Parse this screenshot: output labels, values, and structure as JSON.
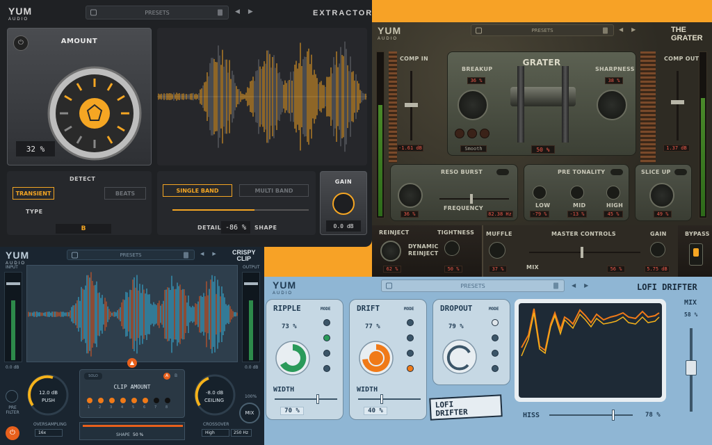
{
  "extractor": {
    "logo": "YUM",
    "logo_sub": "AUDIO",
    "presets": "PRESETS",
    "brand": "EXTRACTOR",
    "amount_label": "AMOUNT",
    "amount_value": "32 %",
    "detect_label": "DETECT",
    "transient_label": "TRANSIENT",
    "beats_label": "BEATS",
    "type_label": "TYPE",
    "type_value": "B",
    "single_band_label": "SINGLE BAND",
    "multi_band_label": "MULTI BAND",
    "detail_label": "DETAIL",
    "detail_value": "-86 %",
    "shape_label": "SHAPE",
    "gain_label": "GAIN",
    "gain_value": "0.0 dB",
    "waveform_color": "#f5a623"
  },
  "grater": {
    "logo": "YUM",
    "logo_sub": "AUDIO",
    "presets": "PRESETS",
    "brand": "THE GRATER",
    "title": "GRATER",
    "comp_in_label": "COMP IN",
    "comp_in_value": "-1.61 dB",
    "comp_out_label": "COMP OUT",
    "comp_out_value": "1.37 dB",
    "breakup_label": "BREAKUP",
    "breakup_value": "36 %",
    "sharpness_label": "SHARPNESS",
    "sharpness_value": "38 %",
    "smooth_label": "Smooth",
    "center_value": "50 %",
    "reso_burst_label": "RESO BURST",
    "reso_value": "36 %",
    "frequency_label": "FREQUENCY",
    "frequency_value": "82.38 Hz",
    "pre_tonality_label": "PRE TONALITY",
    "low_label": "LOW",
    "low_value": "-79 %",
    "mid_label": "MID",
    "mid_value": "-13 %",
    "high_label": "HIGH",
    "high_value": "45 %",
    "slice_up_label": "SLICE UP",
    "slice_up_value": "49 %",
    "reinject_label": "REINJECT",
    "reinject_value": "62 %",
    "dynamic_reinject_label": "DYNAMIC REINJECT",
    "tightness_label": "TIGHTNESS",
    "tightness_value": "50 %",
    "muffle_label": "MUFFLE",
    "muffle_value": "37 %",
    "master_controls_label": "MASTER CONTROLS",
    "mix_label": "MIX",
    "mix_value": "56 %",
    "gain_label": "GAIN",
    "gain_value": "5.75 dB",
    "bypass_label": "BYPASS"
  },
  "crispy": {
    "logo": "YUM",
    "logo_sub": "AUDIO",
    "presets": "PRESETS",
    "brand_line1": "CRISPY",
    "brand_line2": "CLIP",
    "input_label": "INPUT",
    "output_label": "OUTPUT",
    "in_db": "0.0 dB",
    "out_db": "0.0 dB",
    "push_value": "12.0 dB",
    "push_label": "PUSH",
    "clip_amount_label": "CLIP AMOUNT",
    "solo_label": "SOLO",
    "ab_a": "A",
    "ab_b": "B",
    "led_numbers": [
      "1",
      "2",
      "3",
      "4",
      "5",
      "6",
      "7",
      "8"
    ],
    "shape_label": "SHAPE",
    "shape_value": "50 %",
    "ceiling_value": "-8.0 dB",
    "ceiling_label": "CEILING",
    "mix_pct": "100%",
    "mix_label": "MIX",
    "pre_filter_label": "PRE FILTER",
    "oversampling_label": "OVERSAMPLING",
    "oversampling_value": "16x",
    "crossover_label": "CROSSOVER",
    "crossover_value": "High",
    "crossover_hz": "250 Hz",
    "wave_color_a": "#38b6e0",
    "wave_color_b": "#e85a20"
  },
  "lofi": {
    "logo": "YUM",
    "logo_sub": "AUDIO",
    "presets": "PRESETS",
    "brand": "LOFI DRIFTER",
    "ripple_label": "RIPPLE",
    "ripple_value": "73 %",
    "ripple_width_label": "WIDTH",
    "ripple_width_value": "70 %",
    "drift_label": "DRIFT",
    "drift_value": "77 %",
    "drift_width_label": "WIDTH",
    "drift_width_value": "40 %",
    "dropout_label": "DROPOUT",
    "dropout_value": "79 %",
    "mode_label": "MODE",
    "mix_label": "MIX",
    "mix_value": "58 %",
    "hiss_label": "HISS",
    "hiss_value": "78 %",
    "sticker_line1": "LOFI",
    "sticker_line2": "DRIFTER",
    "ripple_color": "#2a9a5a",
    "drift_color": "#f07a18"
  }
}
